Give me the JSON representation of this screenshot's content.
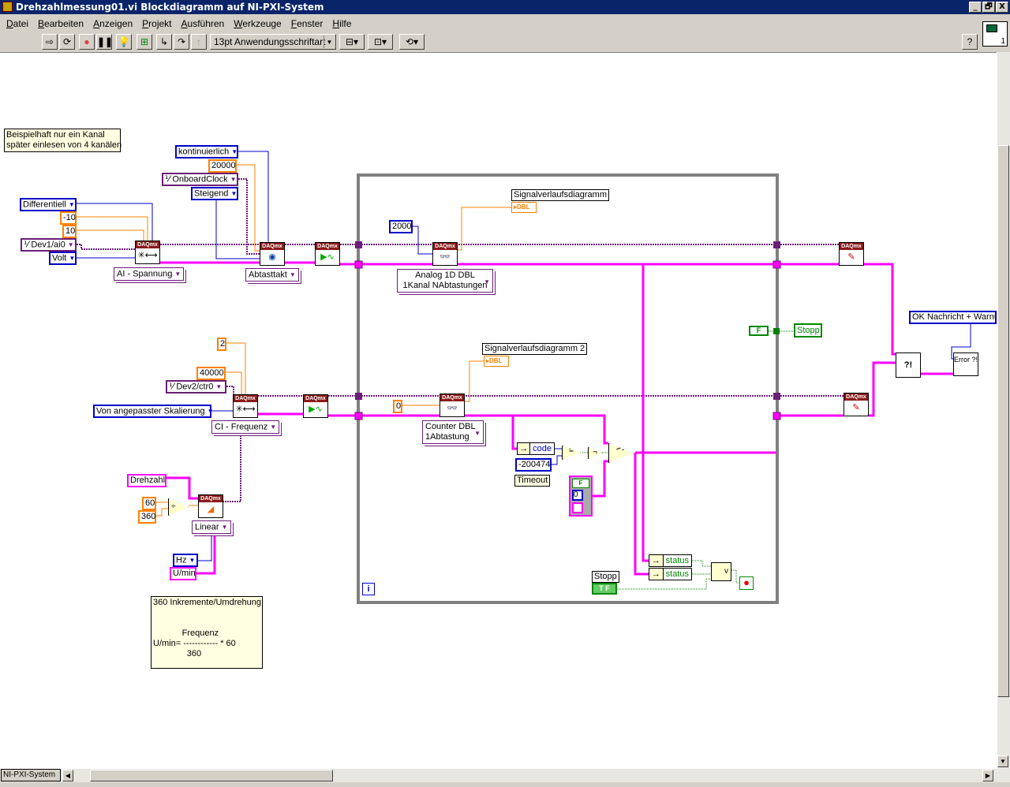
{
  "window": {
    "title": "Drehzahlmessung01.vi Blockdiagramm auf NI-PXI-System",
    "controls": [
      "_",
      "🗗",
      "X"
    ]
  },
  "menu": [
    "Datei",
    "Bearbeiten",
    "Anzeigen",
    "Projekt",
    "Ausführen",
    "Werkzeuge",
    "Fenster",
    "Hilfe"
  ],
  "toolbar": {
    "font": "13pt Anwendungsschriftart",
    "help": "?",
    "vi_icon_number": "1"
  },
  "comments": {
    "channel_note": "Beispielhaft nur ein Kanal\nspäter einlesen von 4 kanälen",
    "formula_note": "360 Inkremente/Umdrehung\n\n\n            Frequenz\nU/min= ------------ * 60\n              360"
  },
  "analog": {
    "sample_mode": "kontinuierlich",
    "rate": "20000",
    "clock_source": "OnboardClock",
    "edge": "Steigend",
    "terminal_config": "Differentiell",
    "min": "-10",
    "max": "10",
    "channel": "Dev1/ai0",
    "units": "Volt",
    "create_channel_type": "AI - Spannung",
    "timing_type": "Abtasttakt",
    "samples": "2000",
    "read_type_line1": "Analog 1D DBL",
    "read_type_line2": "1Kanal NAbtastungen",
    "chart_label": "Signalverlaufsdiagramm",
    "chart_type": "DBL"
  },
  "counter": {
    "edges": "2",
    "max": "40000",
    "channel": "Dev2/ctr0",
    "units": "Von angepasster Skalierung",
    "create_channel_type": "CI - Frequenz",
    "timeout": "0",
    "read_type_line1": "Counter DBL",
    "read_type_line2": "1Abtastung",
    "chart_label": "Signalverlaufsdiagramm 2",
    "chart_type": "DBL"
  },
  "scale": {
    "name": "Drehzahl",
    "c60": "60",
    "c360": "360",
    "type": "Linear",
    "prescaled": "Hz",
    "scaled": "U/min"
  },
  "loop": {
    "error_code_field": "code",
    "timeout_code": "-200474",
    "timeout_label": "Timeout",
    "false_const": "F",
    "tf": "T F",
    "stop_local": "Stopp",
    "cluster_num": "0",
    "status1": "status",
    "status2": "status",
    "or": "v",
    "stop_label": "Stopp",
    "iteration": "i"
  },
  "error": {
    "dialog_type": "OK Nachricht + Warnu",
    "handler": "Error ?!",
    "merge": "?!"
  },
  "daqmx_header": "DAQmx",
  "statusbar": {
    "context": "NI-PXI-System"
  },
  "colors": {
    "error": "#ff00ff",
    "task": "#6b1e78",
    "dbl": "#ff8000",
    "enum": "#0000c8",
    "bool": "#008000",
    "loop": "#808080"
  }
}
